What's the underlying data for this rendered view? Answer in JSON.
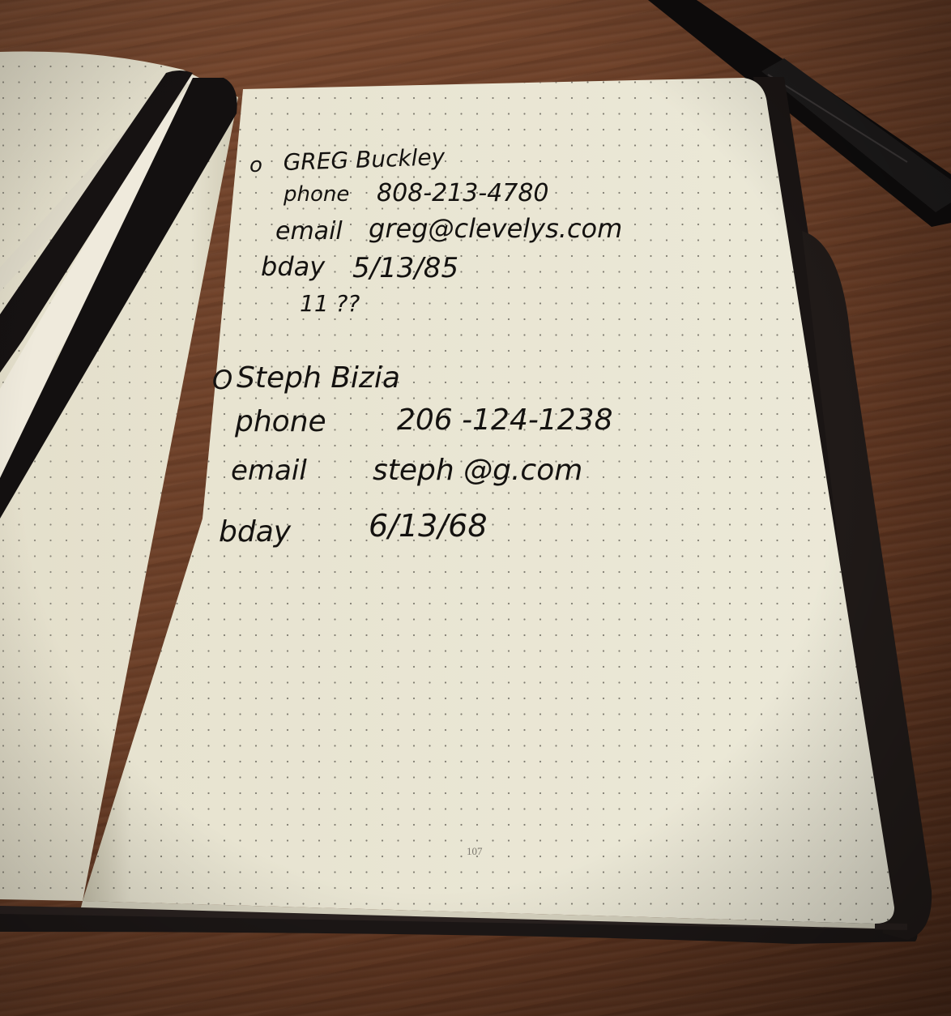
{
  "page_number": "107",
  "entries": [
    {
      "name": "GREG Buckley",
      "phone_label": "phone",
      "phone": "808-213-4780",
      "email_label": "email",
      "email": "greg@clevelys.com",
      "bday_label": "bday",
      "bday": "5/13/85",
      "extra": "11 ??"
    },
    {
      "name": "Steph Bizia",
      "phone_label": "phone",
      "phone": "206 -124-1238",
      "email_label": "email",
      "email": "steph @g.com",
      "bday_label": "bday",
      "bday": "6/13/68"
    }
  ],
  "colors": {
    "paper": "#ece8d6",
    "ink": "#141210",
    "cover": "#1c1716",
    "wood": "#6e4129"
  }
}
